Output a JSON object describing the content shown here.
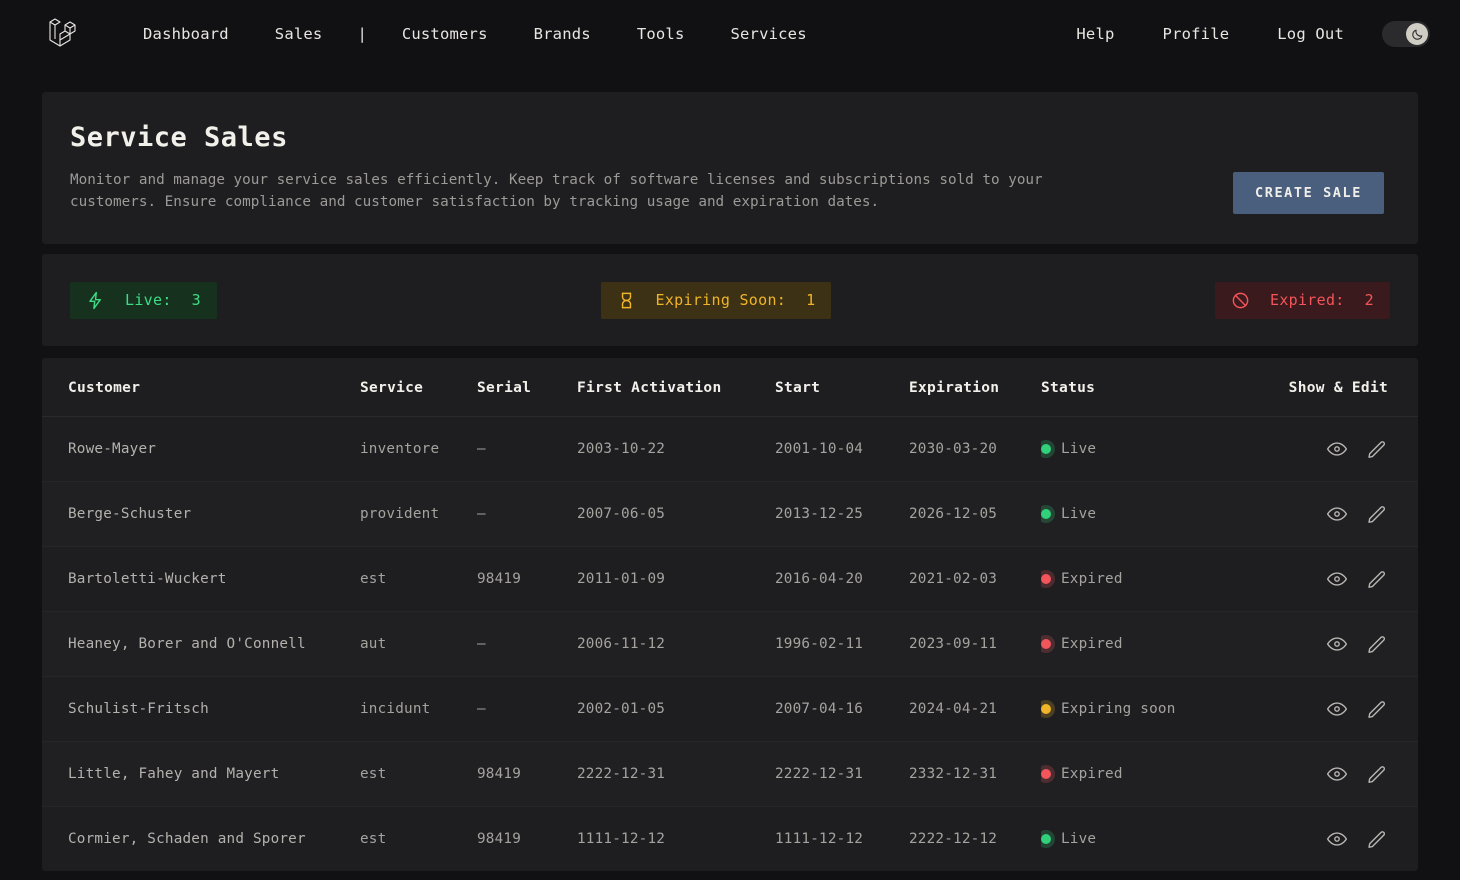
{
  "navbar": {
    "logo_name": "laravel-logo",
    "left_links": [
      "Dashboard",
      "Sales"
    ],
    "separator": "|",
    "mid_links": [
      "Customers",
      "Brands",
      "Tools",
      "Services"
    ],
    "right_links": [
      "Help",
      "Profile",
      "Log Out"
    ],
    "theme_toggle": {
      "state": "dark",
      "icon": "moon-icon"
    }
  },
  "header": {
    "title": "Service Sales",
    "description": "Monitor and manage your service sales efficiently. Keep track of software licenses and subscriptions sold to your customers. Ensure compliance and customer satisfaction by tracking usage and expiration dates.",
    "create_button": "CREATE SALE"
  },
  "stats": [
    {
      "key": "live",
      "icon": "lightning-bolt-icon",
      "label": "Live:",
      "value": "3",
      "color": "#3ddc84",
      "bg": "#16321f"
    },
    {
      "key": "soon",
      "icon": "hourglass-icon",
      "label": "Expiring Soon:",
      "value": "1",
      "color": "#f0b429",
      "bg": "#3c3114"
    },
    {
      "key": "expired",
      "icon": "ban-icon",
      "label": "Expired:",
      "value": "2",
      "color": "#f2555a",
      "bg": "#3a1a1c"
    }
  ],
  "table": {
    "columns": [
      "Customer",
      "Service",
      "Serial",
      "First Activation",
      "Start",
      "Expiration",
      "Status",
      "Show & Edit"
    ],
    "row_actions": {
      "show": "eye-icon",
      "edit": "pencil-icon"
    },
    "rows": [
      {
        "customer": "Rowe-Mayer",
        "service": "inventore",
        "serial": "–",
        "first_activation": "2003-10-22",
        "start": "2001-10-04",
        "expiration": "2030-03-20",
        "status": "Live",
        "status_kind": "live"
      },
      {
        "customer": "Berge-Schuster",
        "service": "provident",
        "serial": "–",
        "first_activation": "2007-06-05",
        "start": "2013-12-25",
        "expiration": "2026-12-05",
        "status": "Live",
        "status_kind": "live"
      },
      {
        "customer": "Bartoletti-Wuckert",
        "service": "est",
        "serial": "98419",
        "first_activation": "2011-01-09",
        "start": "2016-04-20",
        "expiration": "2021-02-03",
        "status": "Expired",
        "status_kind": "expired"
      },
      {
        "customer": "Heaney, Borer and O'Connell",
        "service": "aut",
        "serial": "–",
        "first_activation": "2006-11-12",
        "start": "1996-02-11",
        "expiration": "2023-09-11",
        "status": "Expired",
        "status_kind": "expired"
      },
      {
        "customer": "Schulist-Fritsch",
        "service": "incidunt",
        "serial": "–",
        "first_activation": "2002-01-05",
        "start": "2007-04-16",
        "expiration": "2024-04-21",
        "status": "Expiring soon",
        "status_kind": "soon"
      },
      {
        "customer": "Little, Fahey and Mayert",
        "service": "est",
        "serial": "98419",
        "first_activation": "2222-12-31",
        "start": "2222-12-31",
        "expiration": "2332-12-31",
        "status": "Expired",
        "status_kind": "expired"
      },
      {
        "customer": "Cormier, Schaden and Sporer",
        "service": "est",
        "serial": "98419",
        "first_activation": "1111-12-12",
        "start": "1111-12-12",
        "expiration": "2222-12-12",
        "status": "Live",
        "status_kind": "live"
      }
    ]
  }
}
